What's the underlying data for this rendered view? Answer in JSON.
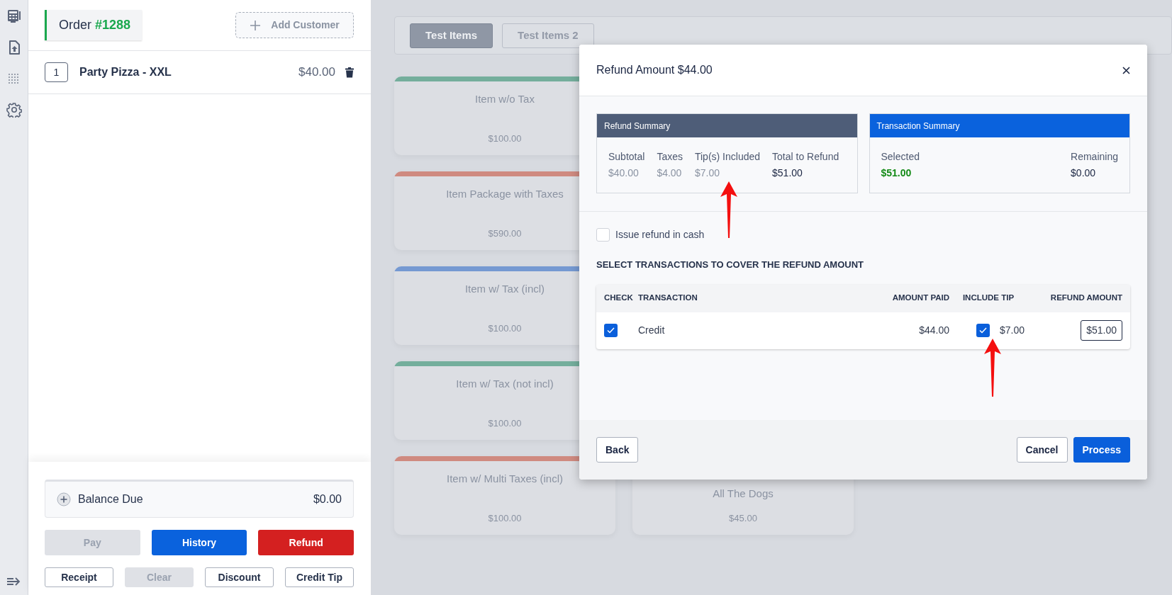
{
  "order": {
    "label": "Order",
    "number": "#1288",
    "add_customer": "Add Customer"
  },
  "order_items": [
    {
      "quantity": "1",
      "name": "Party Pizza - XXL",
      "price": "$40.00"
    }
  ],
  "balance": {
    "label": "Balance Due",
    "amount": "$0.00"
  },
  "main_actions": [
    {
      "label": "Pay",
      "kind": "neutral",
      "disabled": true
    },
    {
      "label": "History",
      "kind": "primary",
      "disabled": false
    },
    {
      "label": "Refund",
      "kind": "danger",
      "disabled": false
    }
  ],
  "secondary_actions": [
    {
      "label": "Receipt",
      "disabled": false
    },
    {
      "label": "Clear",
      "disabled": true
    },
    {
      "label": "Discount",
      "disabled": false
    },
    {
      "label": "Credit Tip",
      "disabled": false
    }
  ],
  "category_tabs": [
    {
      "label": "Test Items",
      "selected": true
    },
    {
      "label": "Test Items 2",
      "selected": false
    }
  ],
  "products": {
    "column_1": [
      {
        "name": "Item w/o Tax",
        "price": "$100.00",
        "color": "#74ae9c"
      },
      {
        "name": "Item Package with Taxes",
        "price": "$590.00",
        "color": "#cf8a80"
      },
      {
        "name": "Item w/ Tax (incl)",
        "price": "$100.00",
        "color": "#7599d2"
      },
      {
        "name": "Item w/ Tax (not incl)",
        "price": "$100.00",
        "color": "#74ae9c"
      },
      {
        "name": "Item w/ Multi Taxes (incl)",
        "price": "$100.00",
        "color": "#cf8a80"
      }
    ],
    "column_2": [
      {
        "name": "All The Dogs",
        "price": "$45.00"
      }
    ]
  },
  "refund_dialog": {
    "title": "Refund Amount $44.00",
    "refund_summary": {
      "title": "Refund Summary",
      "fields": [
        {
          "label": "Subtotal",
          "value": "$40.00",
          "kind": "muted"
        },
        {
          "label": "Taxes",
          "value": "$4.00",
          "kind": "muted"
        },
        {
          "label": "Tip(s) Included",
          "value": "$7.00",
          "kind": "muted"
        },
        {
          "label": "Total to Refund",
          "value": "$51.00",
          "kind": "plain"
        }
      ]
    },
    "transaction_summary": {
      "title": "Transaction Summary",
      "fields": [
        {
          "label": "Selected",
          "value": "$51.00",
          "kind": "positive"
        },
        {
          "label": "Remaining",
          "value": "$0.00",
          "kind": "plain"
        }
      ]
    },
    "cash_refund": {
      "label": "Issue refund in cash",
      "checked": false
    },
    "section_title": "SELECT TRANSACTIONS TO COVER THE REFUND AMOUNT",
    "table": {
      "columns": [
        "CHECK",
        "TRANSACTION",
        "AMOUNT PAID",
        "INCLUDE TIP",
        "REFUND AMOUNT"
      ],
      "rows": [
        {
          "checked": true,
          "transaction": "Credit",
          "amount_paid": "$44.00",
          "include_tip": true,
          "tip": "$7.00",
          "refund_amount": "$51.00"
        }
      ]
    },
    "back_button": "Back",
    "buttons": [
      {
        "label": "Cancel",
        "kind": "outline"
      },
      {
        "label": "Process",
        "kind": "primary"
      }
    ]
  }
}
